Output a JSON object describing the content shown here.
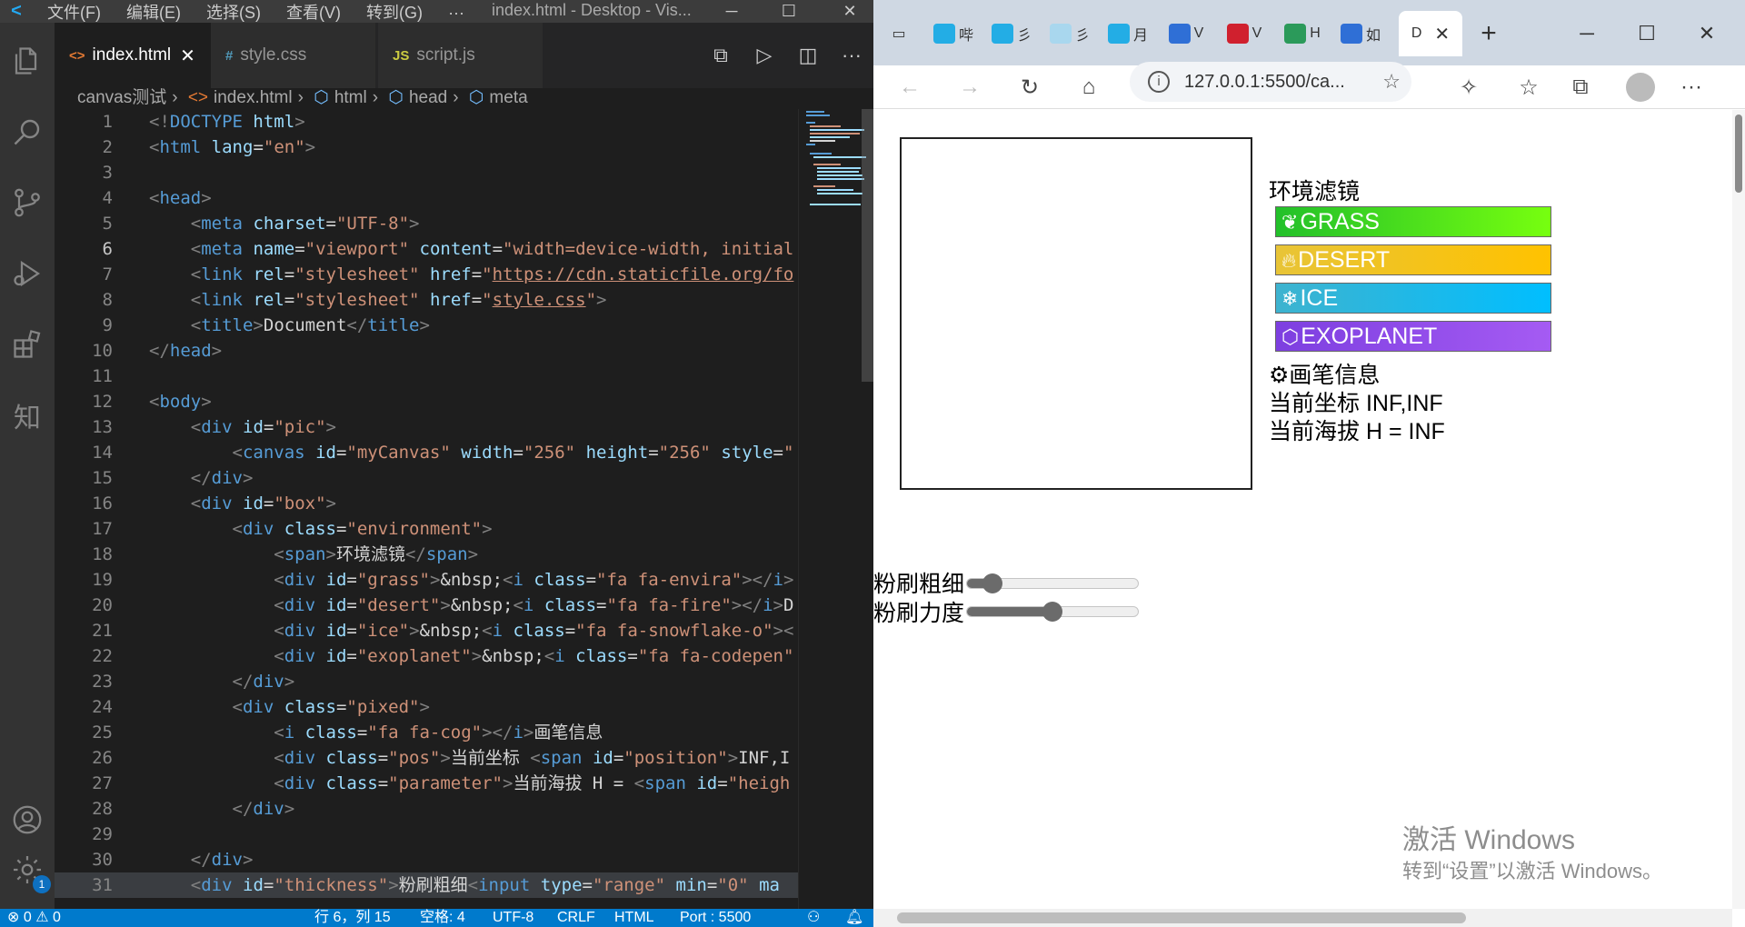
{
  "vscode": {
    "menu": [
      "文件(F)",
      "编辑(E)",
      "选择(S)",
      "查看(V)",
      "转到(G)",
      "···"
    ],
    "window_title": "index.html - Desktop - Vis...",
    "tabs": [
      {
        "label": "index.html",
        "icon": "<>"
      },
      {
        "label": "style.css",
        "icon": "#"
      },
      {
        "label": "script.js",
        "icon": "JS"
      }
    ],
    "breadcrumb": [
      "canvas测试",
      "index.html",
      "html",
      "head",
      "meta"
    ],
    "lines": [
      {
        "n": "1"
      },
      {
        "n": "2"
      },
      {
        "n": "3"
      },
      {
        "n": "4"
      },
      {
        "n": "5"
      },
      {
        "n": "6"
      },
      {
        "n": "7"
      },
      {
        "n": "8"
      },
      {
        "n": "9"
      },
      {
        "n": "10"
      },
      {
        "n": "11"
      },
      {
        "n": "12"
      },
      {
        "n": "13"
      },
      {
        "n": "14"
      },
      {
        "n": "15"
      },
      {
        "n": "16"
      },
      {
        "n": "17"
      },
      {
        "n": "18"
      },
      {
        "n": "19"
      },
      {
        "n": "20"
      },
      {
        "n": "21"
      },
      {
        "n": "22"
      },
      {
        "n": "23"
      },
      {
        "n": "24"
      },
      {
        "n": "25"
      },
      {
        "n": "26"
      },
      {
        "n": "27"
      },
      {
        "n": "28"
      },
      {
        "n": "29"
      },
      {
        "n": "30"
      },
      {
        "n": "31"
      }
    ],
    "code": {
      "l1": "DOCTYPE",
      "l1b": "html",
      "l2": "html",
      "l2a": "lang",
      "l2v": "\"en\"",
      "l4": "head",
      "l5": "meta",
      "l5a": "charset",
      "l5v": "\"UTF-8\"",
      "l6": "meta",
      "l6a": "name",
      "l6v": "\"viewport\"",
      "l6a2": "content",
      "l6v2": "\"width=device-width, initial",
      "l7": "link",
      "l7a": "rel",
      "l7v": "\"stylesheet\"",
      "l7a2": "href",
      "l7v2": "https://cdn.staticfile.org/fo",
      "l8": "link",
      "l8a": "rel",
      "l8v": "\"stylesheet\"",
      "l8a2": "href",
      "l8v2": "style.css",
      "l9": "title",
      "l9t": "Document",
      "l10": "head",
      "l12": "body",
      "l13": "div",
      "l13a": "id",
      "l13v": "\"pic\"",
      "l14": "canvas",
      "l14a": "id",
      "l14v": "\"myCanvas\"",
      "l14a2": "width",
      "l14v2": "\"256\"",
      "l14a3": "height",
      "l14v3": "\"256\"",
      "l14a4": "style",
      "l14v4": "\"",
      "l15": "div",
      "l16": "div",
      "l16a": "id",
      "l16v": "\"box\"",
      "l17": "div",
      "l17a": "class",
      "l17v": "\"environment\"",
      "l18": "span",
      "l18t": "环境滤镜",
      "l19": "div",
      "l19a": "id",
      "l19v": "\"grass\"",
      "l19t": "&nbsp;",
      "l19i": "i",
      "l19ia": "class",
      "l19iv": "\"fa fa-envira\"",
      "l20": "div",
      "l20a": "id",
      "l20v": "\"desert\"",
      "l20t": "&nbsp;",
      "l20i": "i",
      "l20ia": "class",
      "l20iv": "\"fa fa-fire\"",
      "l20e": "D",
      "l21": "div",
      "l21a": "id",
      "l21v": "\"ice\"",
      "l21t": "&nbsp;",
      "l21i": "i",
      "l21ia": "class",
      "l21iv": "\"fa fa-snowflake-o\"",
      "l22": "div",
      "l22a": "id",
      "l22v": "\"exoplanet\"",
      "l22t": "&nbsp;",
      "l22i": "i",
      "l22ia": "class",
      "l22iv": "\"fa fa-codepen\"",
      "l23": "div",
      "l24": "div",
      "l24a": "class",
      "l24v": "\"pixed\"",
      "l25": "i",
      "l25a": "class",
      "l25v": "\"fa fa-cog\"",
      "l25t": "画笔信息",
      "l26": "div",
      "l26a": "class",
      "l26v": "\"pos\"",
      "l26t": "当前坐标 ",
      "l26s": "span",
      "l26sa": "id",
      "l26sv": "\"position\"",
      "l26e": "INF,I",
      "l27": "div",
      "l27a": "class",
      "l27v": "\"parameter\"",
      "l27t": "当前海拔 H = ",
      "l27s": "span",
      "l27sa": "id",
      "l27sv": "\"heigh",
      "l28": "div",
      "l30": "div",
      "l31": "div",
      "l31a": "id",
      "l31v": "\"thickness\"",
      "l31t": "粉刷粗细",
      "l31i": "input",
      "l31ia": "type",
      "l31iv": "\"range\"",
      "l31ia2": "min",
      "l31iv2": "\"0\"",
      "l31ia3": "ma"
    },
    "status": {
      "errors": "⊗ 0 ⚠ 0",
      "position": "行 6，列 15",
      "spaces": "空格: 4",
      "encoding": "UTF-8",
      "eol": "CRLF",
      "language": "HTML",
      "port": "Port : 5500"
    },
    "settings_badge": "1"
  },
  "browser": {
    "tabs": [
      "哔",
      "彡",
      "彡",
      "月",
      "V",
      "V",
      "H",
      "如",
      "D"
    ],
    "address": "127.0.0.1:5500/ca...",
    "env_title": "环境滤镜",
    "env_buttons": [
      {
        "label": "GRASS",
        "icon": "leaf-icon"
      },
      {
        "label": "DESERT",
        "icon": "fire-icon"
      },
      {
        "label": "ICE",
        "icon": "snowflake-icon"
      },
      {
        "label": "EXOPLANET",
        "icon": "codepen-icon"
      }
    ],
    "pen_info": "画笔信息",
    "position_label": "当前坐标 ",
    "position_value": "INF,INF",
    "height_label": "当前海拔 H = ",
    "height_value": "INF",
    "thickness_label": "粉刷粗细",
    "strength_label": "粉刷力度",
    "thickness_value": 0.1,
    "strength_value": 0.5,
    "watermark_title": "激活 Windows",
    "watermark_sub": "转到“设置”以激活 Windows。"
  },
  "colors": {
    "grass": [
      "#22c02a",
      "#77ff0f"
    ],
    "desert": [
      "#e8c437",
      "#ffc200"
    ],
    "ice": [
      "#3eb3cf",
      "#00beff"
    ],
    "exoplanet": [
      "#7d3fe0",
      "#a55bf3"
    ]
  }
}
